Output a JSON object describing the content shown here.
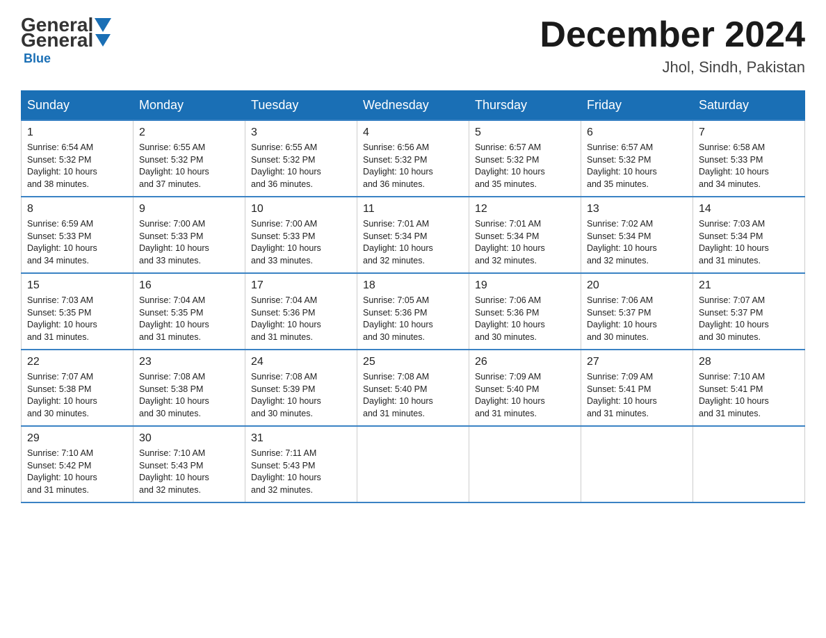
{
  "header": {
    "logo_general": "General",
    "logo_blue": "Blue",
    "month_title": "December 2024",
    "location": "Jhol, Sindh, Pakistan"
  },
  "days_of_week": [
    "Sunday",
    "Monday",
    "Tuesday",
    "Wednesday",
    "Thursday",
    "Friday",
    "Saturday"
  ],
  "weeks": [
    [
      {
        "day": "1",
        "sunrise": "6:54 AM",
        "sunset": "5:32 PM",
        "daylight": "10 hours and 38 minutes."
      },
      {
        "day": "2",
        "sunrise": "6:55 AM",
        "sunset": "5:32 PM",
        "daylight": "10 hours and 37 minutes."
      },
      {
        "day": "3",
        "sunrise": "6:55 AM",
        "sunset": "5:32 PM",
        "daylight": "10 hours and 36 minutes."
      },
      {
        "day": "4",
        "sunrise": "6:56 AM",
        "sunset": "5:32 PM",
        "daylight": "10 hours and 36 minutes."
      },
      {
        "day": "5",
        "sunrise": "6:57 AM",
        "sunset": "5:32 PM",
        "daylight": "10 hours and 35 minutes."
      },
      {
        "day": "6",
        "sunrise": "6:57 AM",
        "sunset": "5:32 PM",
        "daylight": "10 hours and 35 minutes."
      },
      {
        "day": "7",
        "sunrise": "6:58 AM",
        "sunset": "5:33 PM",
        "daylight": "10 hours and 34 minutes."
      }
    ],
    [
      {
        "day": "8",
        "sunrise": "6:59 AM",
        "sunset": "5:33 PM",
        "daylight": "10 hours and 34 minutes."
      },
      {
        "day": "9",
        "sunrise": "7:00 AM",
        "sunset": "5:33 PM",
        "daylight": "10 hours and 33 minutes."
      },
      {
        "day": "10",
        "sunrise": "7:00 AM",
        "sunset": "5:33 PM",
        "daylight": "10 hours and 33 minutes."
      },
      {
        "day": "11",
        "sunrise": "7:01 AM",
        "sunset": "5:34 PM",
        "daylight": "10 hours and 32 minutes."
      },
      {
        "day": "12",
        "sunrise": "7:01 AM",
        "sunset": "5:34 PM",
        "daylight": "10 hours and 32 minutes."
      },
      {
        "day": "13",
        "sunrise": "7:02 AM",
        "sunset": "5:34 PM",
        "daylight": "10 hours and 32 minutes."
      },
      {
        "day": "14",
        "sunrise": "7:03 AM",
        "sunset": "5:34 PM",
        "daylight": "10 hours and 31 minutes."
      }
    ],
    [
      {
        "day": "15",
        "sunrise": "7:03 AM",
        "sunset": "5:35 PM",
        "daylight": "10 hours and 31 minutes."
      },
      {
        "day": "16",
        "sunrise": "7:04 AM",
        "sunset": "5:35 PM",
        "daylight": "10 hours and 31 minutes."
      },
      {
        "day": "17",
        "sunrise": "7:04 AM",
        "sunset": "5:36 PM",
        "daylight": "10 hours and 31 minutes."
      },
      {
        "day": "18",
        "sunrise": "7:05 AM",
        "sunset": "5:36 PM",
        "daylight": "10 hours and 30 minutes."
      },
      {
        "day": "19",
        "sunrise": "7:06 AM",
        "sunset": "5:36 PM",
        "daylight": "10 hours and 30 minutes."
      },
      {
        "day": "20",
        "sunrise": "7:06 AM",
        "sunset": "5:37 PM",
        "daylight": "10 hours and 30 minutes."
      },
      {
        "day": "21",
        "sunrise": "7:07 AM",
        "sunset": "5:37 PM",
        "daylight": "10 hours and 30 minutes."
      }
    ],
    [
      {
        "day": "22",
        "sunrise": "7:07 AM",
        "sunset": "5:38 PM",
        "daylight": "10 hours and 30 minutes."
      },
      {
        "day": "23",
        "sunrise": "7:08 AM",
        "sunset": "5:38 PM",
        "daylight": "10 hours and 30 minutes."
      },
      {
        "day": "24",
        "sunrise": "7:08 AM",
        "sunset": "5:39 PM",
        "daylight": "10 hours and 30 minutes."
      },
      {
        "day": "25",
        "sunrise": "7:08 AM",
        "sunset": "5:40 PM",
        "daylight": "10 hours and 31 minutes."
      },
      {
        "day": "26",
        "sunrise": "7:09 AM",
        "sunset": "5:40 PM",
        "daylight": "10 hours and 31 minutes."
      },
      {
        "day": "27",
        "sunrise": "7:09 AM",
        "sunset": "5:41 PM",
        "daylight": "10 hours and 31 minutes."
      },
      {
        "day": "28",
        "sunrise": "7:10 AM",
        "sunset": "5:41 PM",
        "daylight": "10 hours and 31 minutes."
      }
    ],
    [
      {
        "day": "29",
        "sunrise": "7:10 AM",
        "sunset": "5:42 PM",
        "daylight": "10 hours and 31 minutes."
      },
      {
        "day": "30",
        "sunrise": "7:10 AM",
        "sunset": "5:43 PM",
        "daylight": "10 hours and 32 minutes."
      },
      {
        "day": "31",
        "sunrise": "7:11 AM",
        "sunset": "5:43 PM",
        "daylight": "10 hours and 32 minutes."
      },
      null,
      null,
      null,
      null
    ]
  ],
  "labels": {
    "sunrise": "Sunrise:",
    "sunset": "Sunset:",
    "daylight": "Daylight:"
  }
}
